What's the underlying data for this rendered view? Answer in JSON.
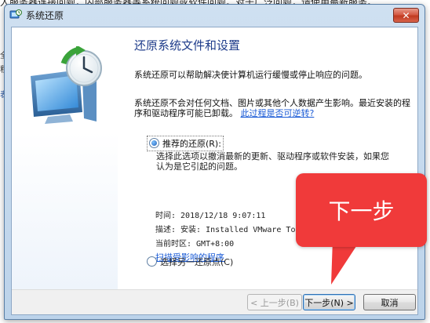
{
  "background": {
    "top_text": "人服务器连接问题，内部服务器等系统问题或软件问题。对于广泛问题，请使用最新服务。",
    "side_glyphs": [
      "全",
      "程",
      "表"
    ]
  },
  "dialog": {
    "title": "系统还原",
    "close_label": "✕",
    "heading": "还原系统文件和设置",
    "para1": "系统还原可以帮助解决使计算机运行缓慢或停止响应的问题。",
    "para2": "系统还原不会对任何文档、图片或其他个人数据产生影响。最近安装的程序和驱动程序可能已卸载。",
    "para2_link": "此过程是否可逆转?",
    "recommended": {
      "label": "推荐的还原(R):",
      "desc": "选择此选项以撤消最新的更新、驱动程序或软件安装，如果您认为是它引起的问题。",
      "time": "时间: 2018/12/18 9:07:11",
      "description": "描述: 安装: Installed VMware Tools",
      "timezone": "当前时区: GMT+8:00",
      "scan_link": "扫描受影响的程序"
    },
    "choose_other": "选择另一还原点(C)",
    "buttons": {
      "prev": "< 上一步(B)",
      "next": "下一步(N) >",
      "cancel": "取消"
    }
  },
  "callout": {
    "text": "下一步",
    "color": "#f03a3a"
  }
}
